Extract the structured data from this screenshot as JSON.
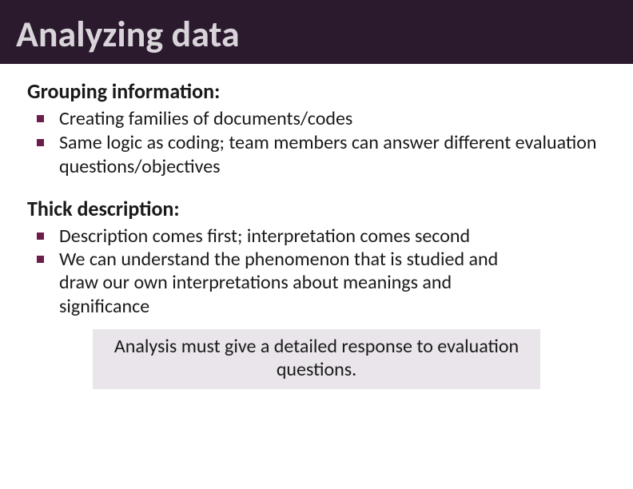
{
  "header": {
    "title": "Analyzing data"
  },
  "sections": [
    {
      "heading": "Grouping information:",
      "bullets": [
        "Creating families of documents/codes",
        "Same logic as coding; team members can answer different evaluation questions/objectives"
      ]
    },
    {
      "heading": "Thick description:",
      "bullets": [
        "Description comes first; interpretation comes second",
        "We can understand the phenomenon that is studied and draw our own interpretations about meanings and significance"
      ]
    }
  ],
  "callout": "Analysis must give a detailed response to evaluation questions."
}
